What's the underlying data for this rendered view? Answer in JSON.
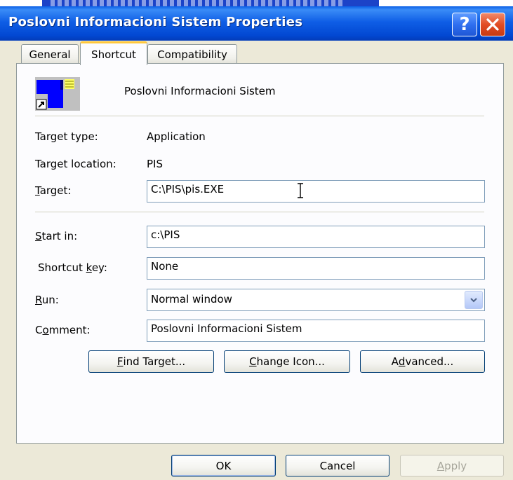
{
  "window": {
    "title": "Poslovni Informacioni Sistem Properties",
    "help_glyph": "?",
    "accent": "#0248d2",
    "close_color": "#e24c24"
  },
  "tabs": [
    {
      "label": "General",
      "selected": false
    },
    {
      "label": "Shortcut",
      "selected": true
    },
    {
      "label": "Compatibility",
      "selected": false
    }
  ],
  "shortcut": {
    "app_name": "Poslovni Informacioni Sistem",
    "icon": "application-shortcut-icon",
    "target_type_label": "Target type:",
    "target_type_value": "Application",
    "target_location_label": "Target location:",
    "target_location_value": "PIS",
    "target_label_pre": "",
    "target_label_acc": "T",
    "target_label_post": "arget:",
    "target_value": "C:\\PIS\\pis.EXE",
    "start_in_label_acc": "S",
    "start_in_label_post": "tart in:",
    "start_in_value": "c:\\PIS",
    "shortcut_key_label_pre": "Shortcut ",
    "shortcut_key_label_acc": "k",
    "shortcut_key_label_post": "ey:",
    "shortcut_key_value": "None",
    "run_label_acc": "R",
    "run_label_post": "un:",
    "run_value": "Normal window",
    "comment_label_pre": "C",
    "comment_label_acc": "o",
    "comment_label_post": "mment:",
    "comment_value": "Poslovni Informacioni Sistem"
  },
  "buttons": {
    "find_target_acc": "F",
    "find_target_post": "ind Target...",
    "change_icon_acc": "C",
    "change_icon_post": "hange Icon...",
    "advanced_pre": "A",
    "advanced_acc": "d",
    "advanced_post": "vanced...",
    "ok": "OK",
    "cancel": "Cancel",
    "apply_acc": "A",
    "apply_post": "pply"
  }
}
